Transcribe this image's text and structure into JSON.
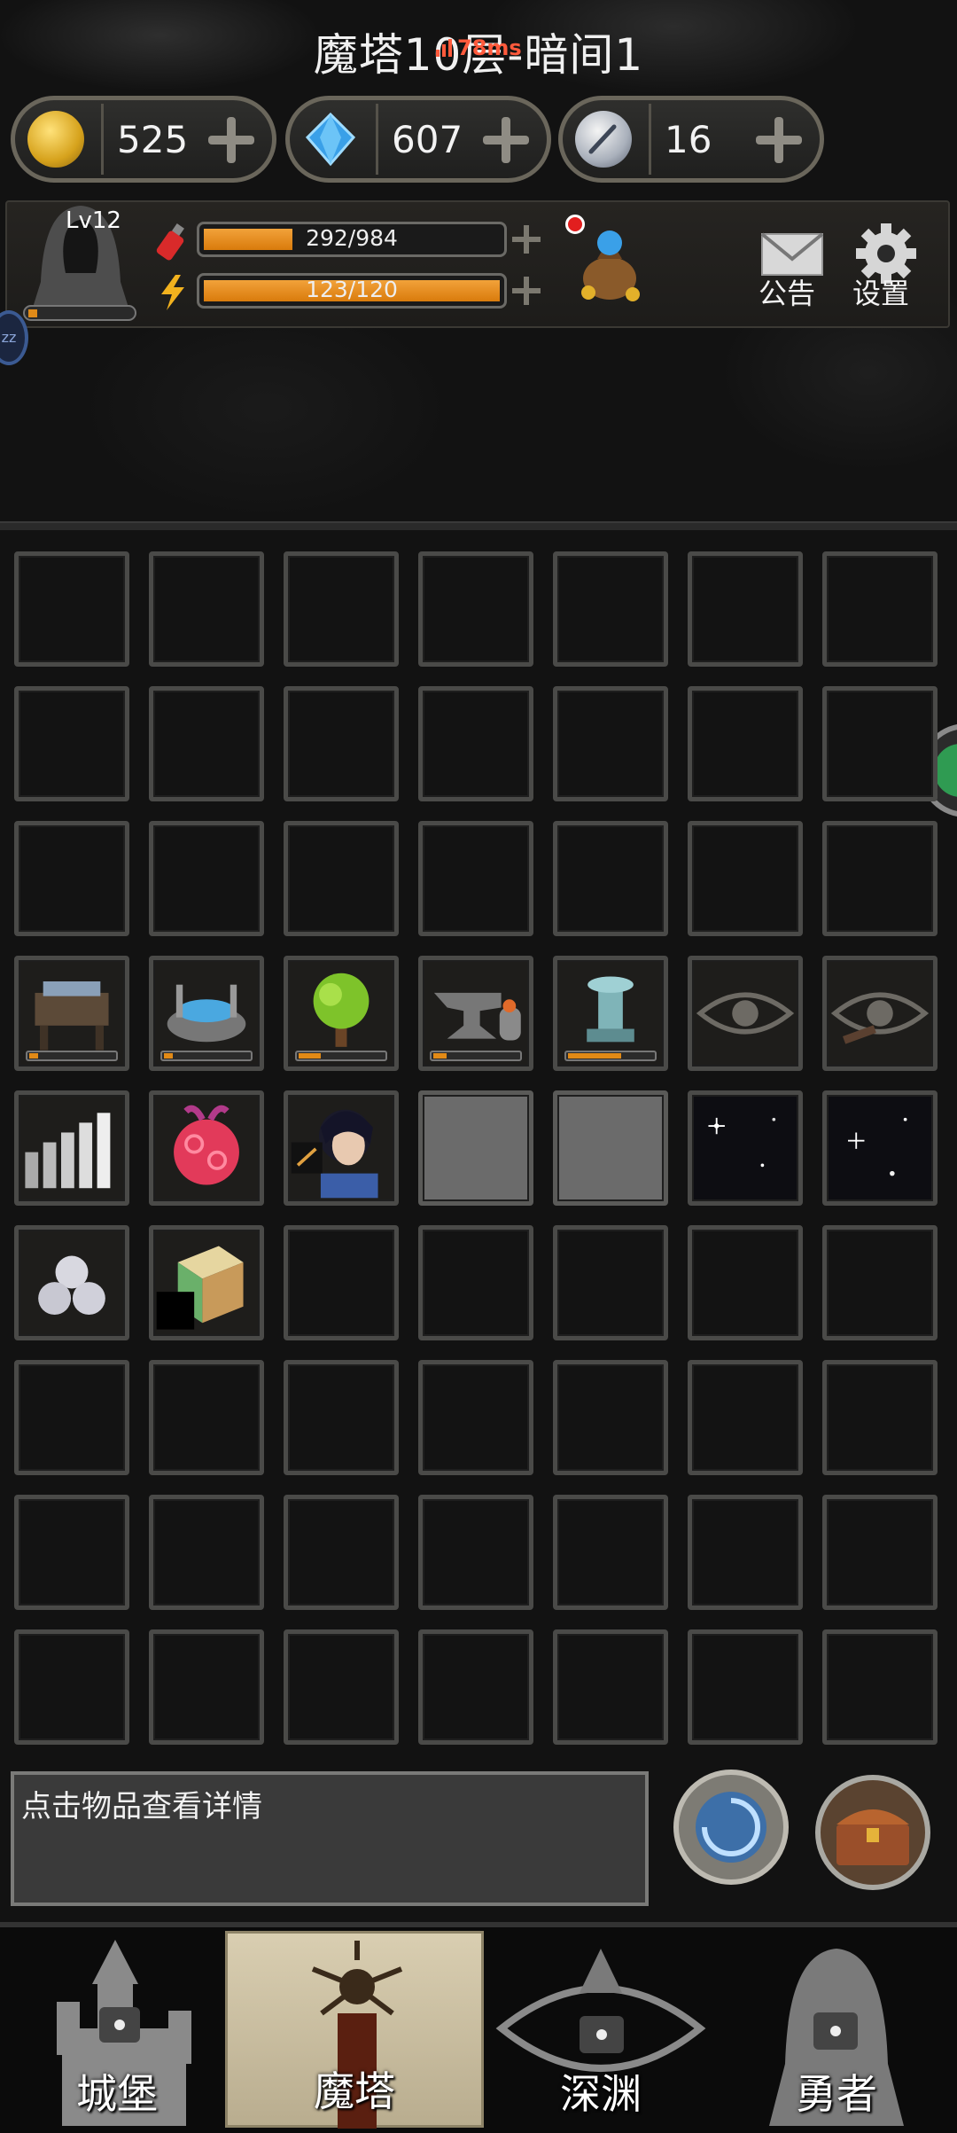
{
  "header": {
    "title": "魔塔10层-暗间1",
    "ping": "78ms"
  },
  "currencies": [
    {
      "icon": "gold-coin-icon",
      "value": "525"
    },
    {
      "icon": "blue-diamond-icon",
      "value": "607"
    },
    {
      "icon": "silver-feather-coin-icon",
      "value": "16"
    }
  ],
  "player": {
    "level": "Lv12",
    "hp": "292/984",
    "hp_fraction": 0.3,
    "energy": "123/120",
    "energy_fraction": 1.0,
    "xp_fraction": 0.06
  },
  "top_buttons": {
    "notice_label": "公告",
    "settings_label": "设置"
  },
  "message": {
    "text": "点击物品查看详情"
  },
  "nav": {
    "tabs": [
      {
        "label": "城堡",
        "icon": "castle-lock-icon",
        "active": false
      },
      {
        "label": "魔塔",
        "icon": "tower-icon",
        "active": true
      },
      {
        "label": "深渊",
        "icon": "abyss-eye-lock-icon",
        "active": false
      },
      {
        "label": "勇者",
        "icon": "hero-lock-icon",
        "active": false
      }
    ]
  },
  "colors": {
    "accent_orange": "#e28a16",
    "background": "#121212",
    "slot_border": "#4a4a48",
    "notification_red": "#e21e1e"
  }
}
